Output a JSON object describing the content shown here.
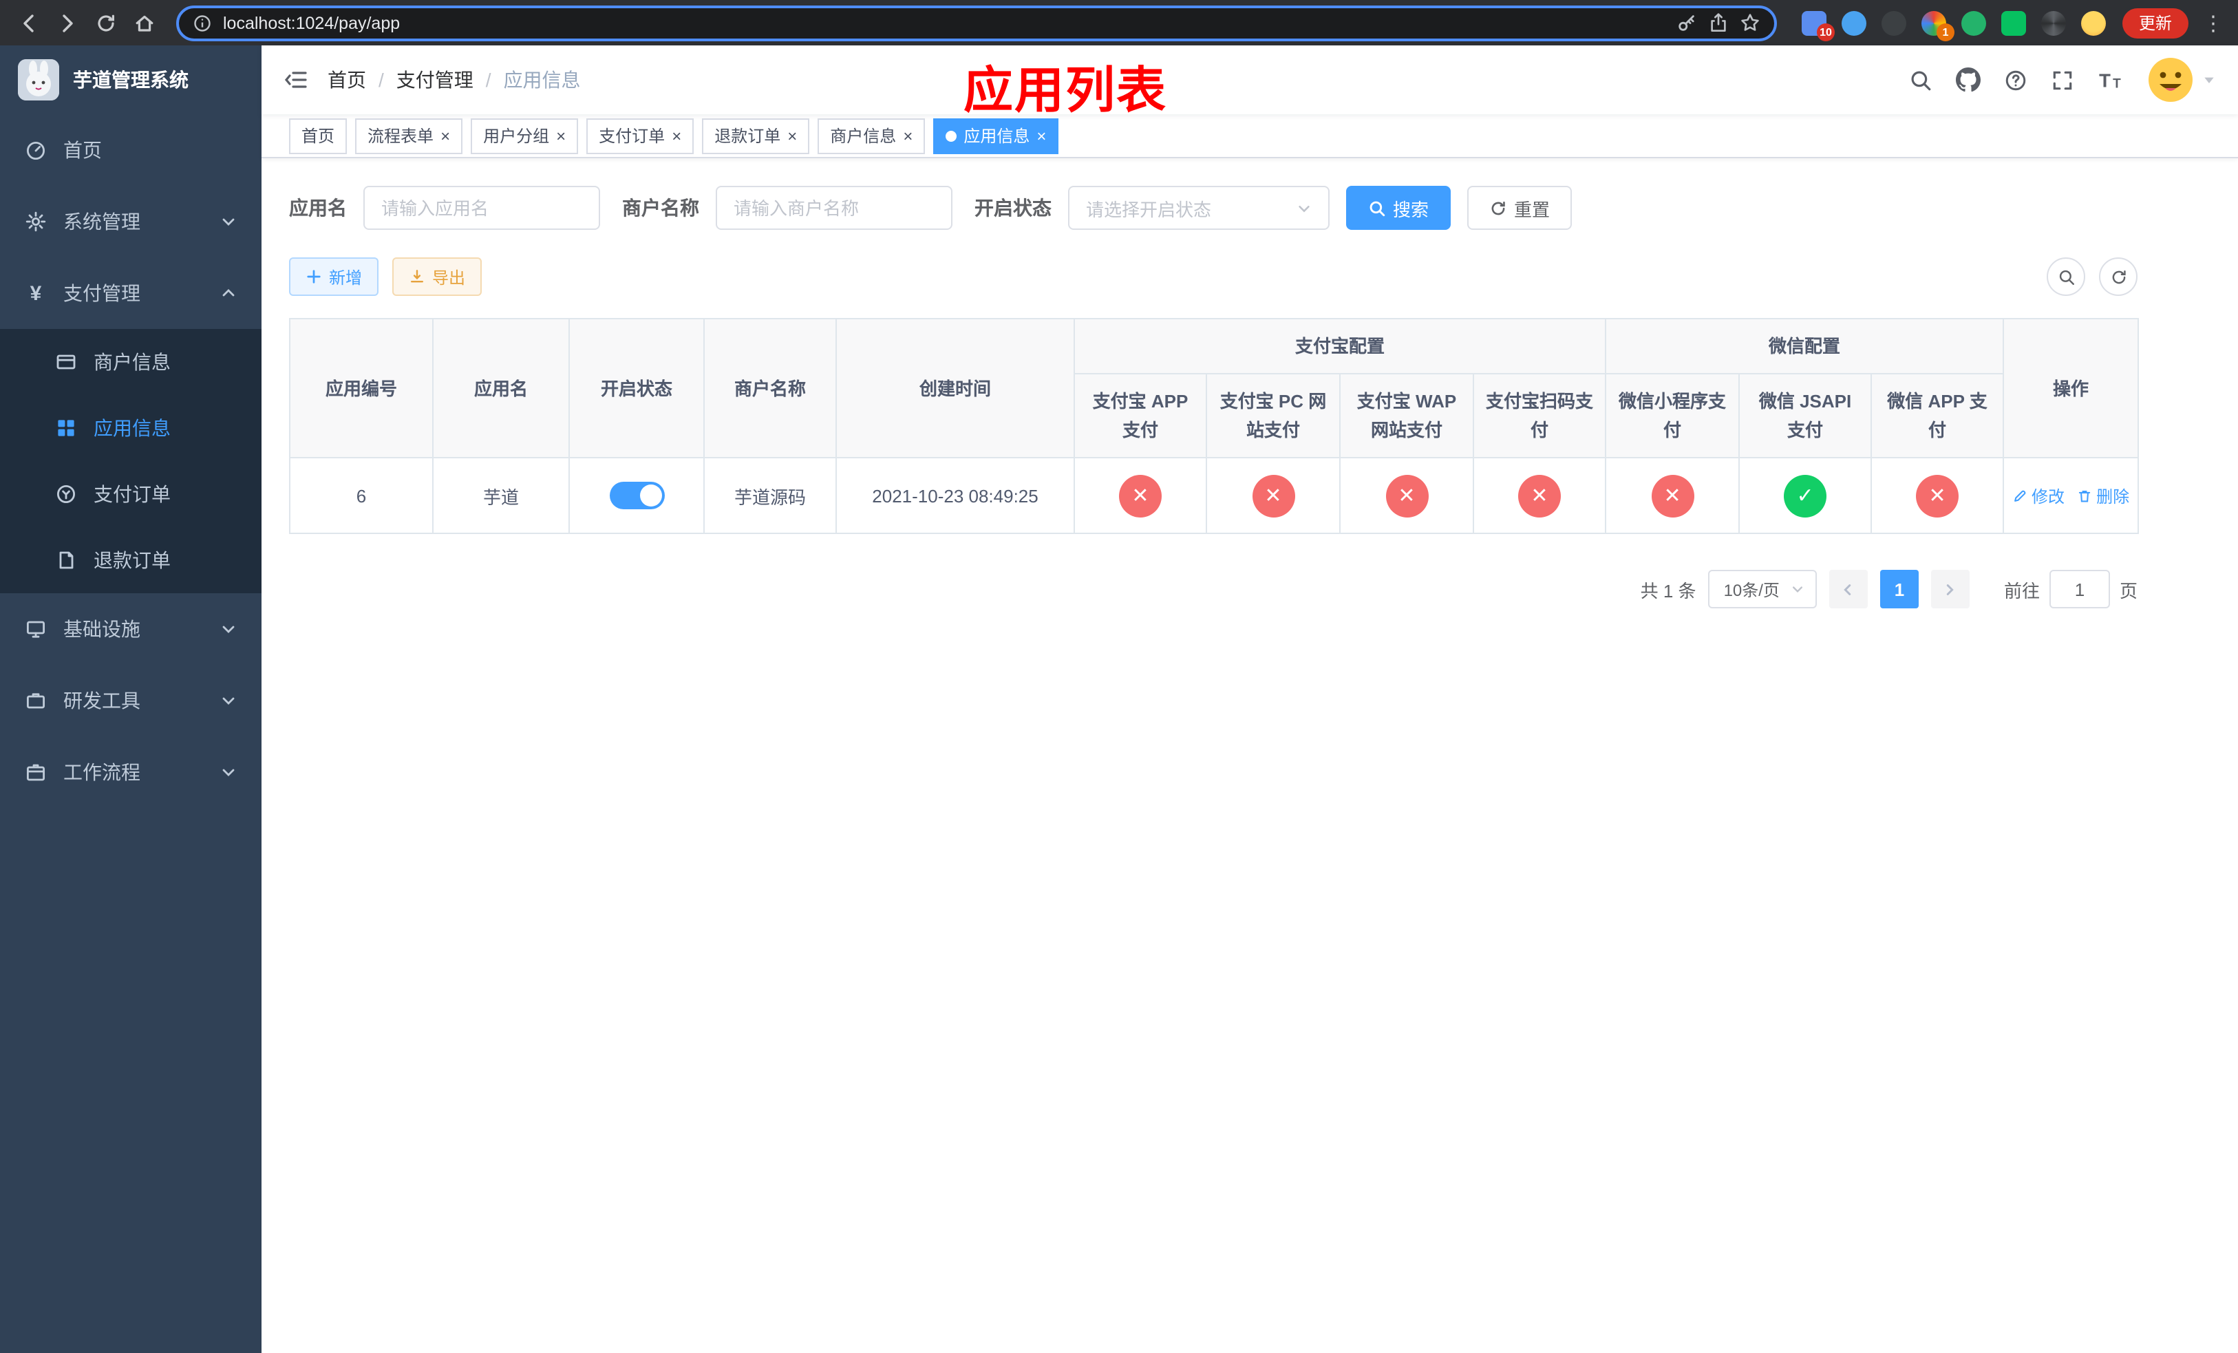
{
  "browser": {
    "url": "localhost:1024/pay/app",
    "update_button": "更新",
    "badge_extensions": "10",
    "badge_profile": "1"
  },
  "sidebar": {
    "logo_title": "芋道管理系统",
    "menu": [
      {
        "label": "首页"
      },
      {
        "label": "系统管理"
      },
      {
        "label": "支付管理"
      },
      {
        "label": "基础设施"
      },
      {
        "label": "研发工具"
      },
      {
        "label": "工作流程"
      }
    ],
    "submenu": [
      {
        "label": "商户信息"
      },
      {
        "label": "应用信息"
      },
      {
        "label": "支付订单"
      },
      {
        "label": "退款订单"
      }
    ]
  },
  "header": {
    "breadcrumb": [
      "首页",
      "支付管理",
      "应用信息"
    ],
    "annotation": "应用列表"
  },
  "tabs": [
    {
      "label": "首页"
    },
    {
      "label": "流程表单"
    },
    {
      "label": "用户分组"
    },
    {
      "label": "支付订单"
    },
    {
      "label": "退款订单"
    },
    {
      "label": "商户信息"
    },
    {
      "label": "应用信息"
    }
  ],
  "filters": {
    "app_name_label": "应用名",
    "app_name_placeholder": "请输入应用名",
    "merchant_label": "商户名称",
    "merchant_placeholder": "请输入商户名称",
    "status_label": "开启状态",
    "status_placeholder": "请选择开启状态",
    "search_button": "搜索",
    "reset_button": "重置"
  },
  "toolbar": {
    "add_button": "新增",
    "export_button": "导出"
  },
  "table": {
    "group_headers": {
      "alipay": "支付宝配置",
      "wechat": "微信配置"
    },
    "columns": {
      "app_id": "应用编号",
      "app_name": "应用名",
      "status": "开启状态",
      "merchant": "商户名称",
      "created": "创建时间",
      "alipay_app": "支付宝 APP 支付",
      "alipay_pc": "支付宝 PC 网站支付",
      "alipay_wap": "支付宝 WAP 网站支付",
      "alipay_qr": "支付宝扫码支付",
      "wx_mini": "微信小程序支付",
      "wx_jsapi": "微信 JSAPI 支付",
      "wx_app": "微信 APP 支付",
      "actions": "操作"
    },
    "row": {
      "app_id": "6",
      "app_name": "芋道",
      "status_on": true,
      "merchant": "芋道源码",
      "created": "2021-10-23 08:49:25",
      "configs": [
        false,
        false,
        false,
        false,
        false,
        true,
        false
      ],
      "edit_label": "修改",
      "delete_label": "删除"
    },
    "glyphs": {
      "ok": "✓",
      "fail": "✕"
    }
  },
  "pagination": {
    "total": "共 1 条",
    "page_size": "10条/页",
    "current_page": "1",
    "goto_label": "前往",
    "goto_value": "1",
    "page_unit": "页"
  },
  "colors": {
    "primary": "#409eff",
    "success": "#13ce66",
    "danger": "#f56c6c",
    "annotation": "#ff0000",
    "sidebar_bg": "#304156",
    "submenu_bg": "#1f2d3d"
  }
}
